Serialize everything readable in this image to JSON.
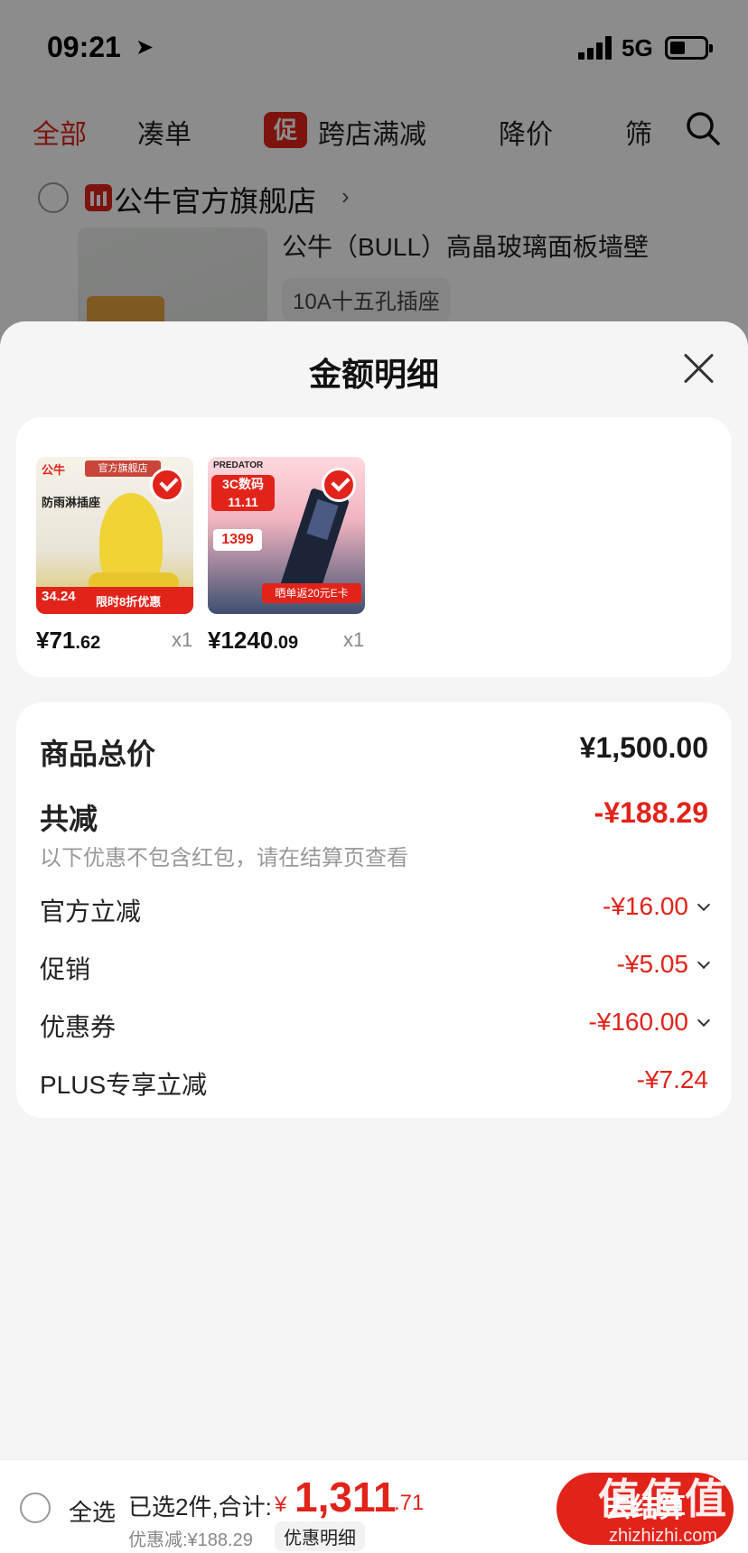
{
  "status": {
    "time": "09:21",
    "network": "5G"
  },
  "filters": {
    "all": "全部",
    "combine": "凑单",
    "promo_badge": "促",
    "cross_store": "跨店满减",
    "price_drop": "降价",
    "filter": "筛"
  },
  "store": {
    "name": "公牛官方旗舰店",
    "product_title": "公牛（BULL）高晶玻璃面板墙壁",
    "spec": "10A十五孔插座"
  },
  "sheet": {
    "title": "金额明细",
    "items": [
      {
        "price_int": "¥71",
        "price_dec": ".62",
        "qty": "x1",
        "img_brand": "公牛",
        "img_shop": "官方旗舰店",
        "img_label": "防雨淋插座",
        "img_tag_price": "34.24",
        "img_tag_disc": "限时8折优惠"
      },
      {
        "price_int": "¥1240",
        "price_dec": ".09",
        "qty": "x1",
        "img_brand": "PREDATOR",
        "img_promo": "3C数码 11.11",
        "img_price": "1399",
        "img_bar": "晒单返20元E卡"
      }
    ],
    "details": {
      "total_label": "商品总价",
      "total_value": "¥1,500.00",
      "reduce_label": "共减",
      "reduce_value": "-¥188.29",
      "note": "以下优惠不包含红包，请在结算页查看",
      "lines": [
        {
          "label": "官方立减",
          "value": "-¥16.00"
        },
        {
          "label": "促销",
          "value": "-¥5.05"
        },
        {
          "label": "优惠券",
          "value": "-¥160.00"
        },
        {
          "label": "PLUS专享立减",
          "value": "-¥7.24"
        }
      ]
    }
  },
  "bottom": {
    "select_all": "全选",
    "summary": "已选2件,合计:",
    "currency": "¥",
    "total_int": "1,311",
    "total_dec": ".71",
    "discount": "优惠减:¥188.29",
    "detail_link": "优惠明细",
    "checkout": "去结算"
  },
  "watermark": {
    "main": "值值值",
    "sub": "zhizhizhi.com"
  },
  "colors": {
    "accent": "#e2231a",
    "sheet_bg": "#f5f5f5"
  }
}
